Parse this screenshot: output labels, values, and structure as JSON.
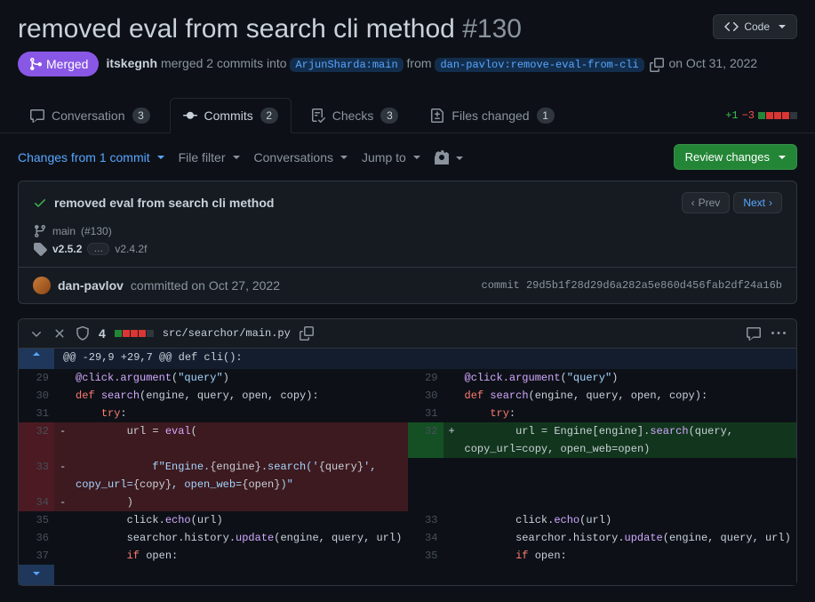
{
  "header": {
    "title": "removed eval from search cli method",
    "pr_number": "#130",
    "code_btn": "Code",
    "merge_state": "Merged",
    "merge_author": "itskegnh",
    "merge_text_a": "merged 2 commits into",
    "base_branch": "ArjunSharda:main",
    "merge_text_b": "from",
    "head_branch": "dan-pavlov:remove-eval-from-cli",
    "merge_date": "on Oct 31, 2022"
  },
  "tabs": {
    "conversation": {
      "label": "Conversation",
      "count": "3"
    },
    "commits": {
      "label": "Commits",
      "count": "2"
    },
    "checks": {
      "label": "Checks",
      "count": "3"
    },
    "files": {
      "label": "Files changed",
      "count": "1"
    },
    "additions": "+1",
    "deletions": "−3"
  },
  "toolbar": {
    "changes": "Changes from 1 commit",
    "filefilter": "File filter",
    "conversations": "Conversations",
    "jumpto": "Jump to",
    "review": "Review changes"
  },
  "commit": {
    "title": "removed eval from search cli method",
    "prev": "Prev",
    "next": "Next",
    "branch": "main",
    "pr_ref": "(#130)",
    "tag1": "v2.5.2",
    "tag_more": "…",
    "tag2": "v2.4.2f",
    "author": "dan-pavlov",
    "committed_text": "committed on Oct 27, 2022",
    "sha_label": "commit",
    "sha": "29d5b1f28d29d6a282a5e860d456fab2df24a16b"
  },
  "file": {
    "changes": "4",
    "path": "src/searchor/main.py",
    "hunk": "@@ -29,9 +29,7 @@ def cli():"
  },
  "diff": {
    "left": [
      {
        "n": "29",
        "html": "<span class=\"dec\">@click.argument</span>(<span class=\"str\">\"query\"</span>)"
      },
      {
        "n": "30",
        "html": "<span class=\"kw\">def</span> <span class=\"fn\">search</span>(engine, query, open, copy):"
      },
      {
        "n": "31",
        "html": "    <span class=\"kw\">try</span>:"
      },
      {
        "n": "32",
        "html": "        url = <span class=\"fn\">eval</span>(",
        "type": "del"
      },
      {
        "n": "33",
        "html": "            <span class=\"str\">f\"Engine.</span>{engine}<span class=\"str\">.search('</span>{query}<span class=\"str\">', copy_url=</span>{copy}<span class=\"str\">, open_web=</span>{open}<span class=\"str\">)\"</span>",
        "type": "del"
      },
      {
        "n": "34",
        "html": "        )",
        "type": "del"
      },
      {
        "n": "35",
        "html": "        click.<span class=\"fn\">echo</span>(url)"
      },
      {
        "n": "36",
        "html": "        searchor.history.<span class=\"fn\">update</span>(engine, query, url)"
      },
      {
        "n": "37",
        "html": "        <span class=\"kw\">if</span> open:"
      }
    ],
    "right": [
      {
        "n": "29",
        "html": "<span class=\"dec\">@click.argument</span>(<span class=\"str\">\"query\"</span>)"
      },
      {
        "n": "30",
        "html": "<span class=\"kw\">def</span> <span class=\"fn\">search</span>(engine, query, open, copy):"
      },
      {
        "n": "31",
        "html": "    <span class=\"kw\">try</span>:"
      },
      {
        "n": "32",
        "html": "        url = Engine[engine].<span class=\"fn\">search</span>(query, <span class=\"op\">copy_url</span>=copy, <span class=\"op\">open_web</span>=open)",
        "type": "add"
      },
      {
        "n": "",
        "html": "",
        "type": "pad"
      },
      {
        "n": "",
        "html": "",
        "type": "pad"
      },
      {
        "n": "33",
        "html": "        click.<span class=\"fn\">echo</span>(url)"
      },
      {
        "n": "34",
        "html": "        searchor.history.<span class=\"fn\">update</span>(engine, query, url)"
      },
      {
        "n": "35",
        "html": "        <span class=\"kw\">if</span> open:"
      }
    ]
  }
}
